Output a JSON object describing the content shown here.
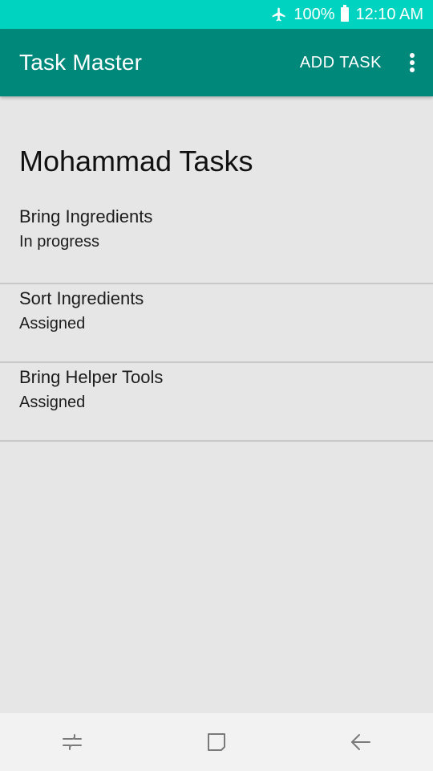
{
  "status_bar": {
    "battery_percent": "100%",
    "time": "12:10 AM",
    "icons": [
      "airplane-icon",
      "battery-icon"
    ]
  },
  "app_bar": {
    "title": "Task Master",
    "add_task_label": "ADD TASK",
    "overflow_icon": "more-vert-icon",
    "color": "#00897b"
  },
  "page": {
    "title": "Mohammad Tasks"
  },
  "tasks": [
    {
      "name": "Bring Ingredients",
      "status": "In progress"
    },
    {
      "name": "Sort Ingredients",
      "status": "Assigned"
    },
    {
      "name": "Bring Helper Tools",
      "status": "Assigned"
    }
  ],
  "nav_bar": {
    "icons": [
      "recent-apps-icon",
      "home-icon",
      "back-icon"
    ]
  },
  "colors": {
    "status_bar": "#00d4c0",
    "app_bar": "#00897b",
    "background": "#e6e6e6"
  }
}
